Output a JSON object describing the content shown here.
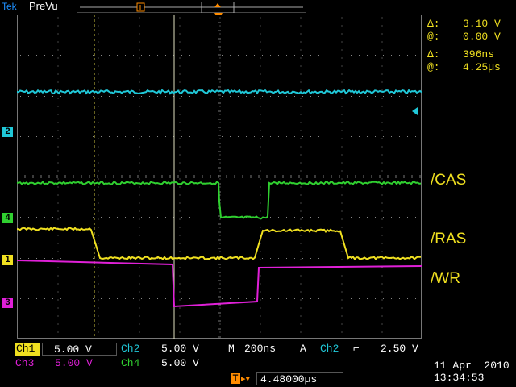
{
  "header": {
    "brand": "Tek",
    "mode": "PreVu"
  },
  "cursor_readout": {
    "delta_v_symbol": "Δ:",
    "delta_v": "3.10 V",
    "at_v_symbol": "@:",
    "at_v": "0.00 V",
    "delta_t_symbol": "Δ:",
    "delta_t": "396ns",
    "at_t_symbol": "@:",
    "at_t": "4.25µs"
  },
  "signal_labels": {
    "cas": "/CAS",
    "ras": "/RAS",
    "wr": "/WR"
  },
  "channel_markers": {
    "ch1": "1",
    "ch2": "2",
    "ch3": "3",
    "ch4": "4",
    "trigger": "T"
  },
  "channels": {
    "ch1_label": "Ch1",
    "ch1_scale": "5.00 V",
    "ch2_label": "Ch2",
    "ch2_scale": "5.00 V",
    "ch3_label": "Ch3",
    "ch3_scale": "5.00 V",
    "ch4_label": "Ch4",
    "ch4_scale": "5.00 V"
  },
  "timebase": {
    "m_label": "M",
    "value": "200ns"
  },
  "trigger": {
    "a_label": "A",
    "source": "Ch2",
    "slope_symbol": "⌐",
    "level": "2.50 V",
    "position": "4.48000µs"
  },
  "datetime": {
    "date": "11 Apr  2010",
    "time": "13:34:53"
  },
  "colors": {
    "ch1": "#f0e020",
    "ch2": "#20c8d8",
    "ch3": "#e020d8",
    "ch4": "#30d030",
    "trigger": "#ff8c00"
  }
}
